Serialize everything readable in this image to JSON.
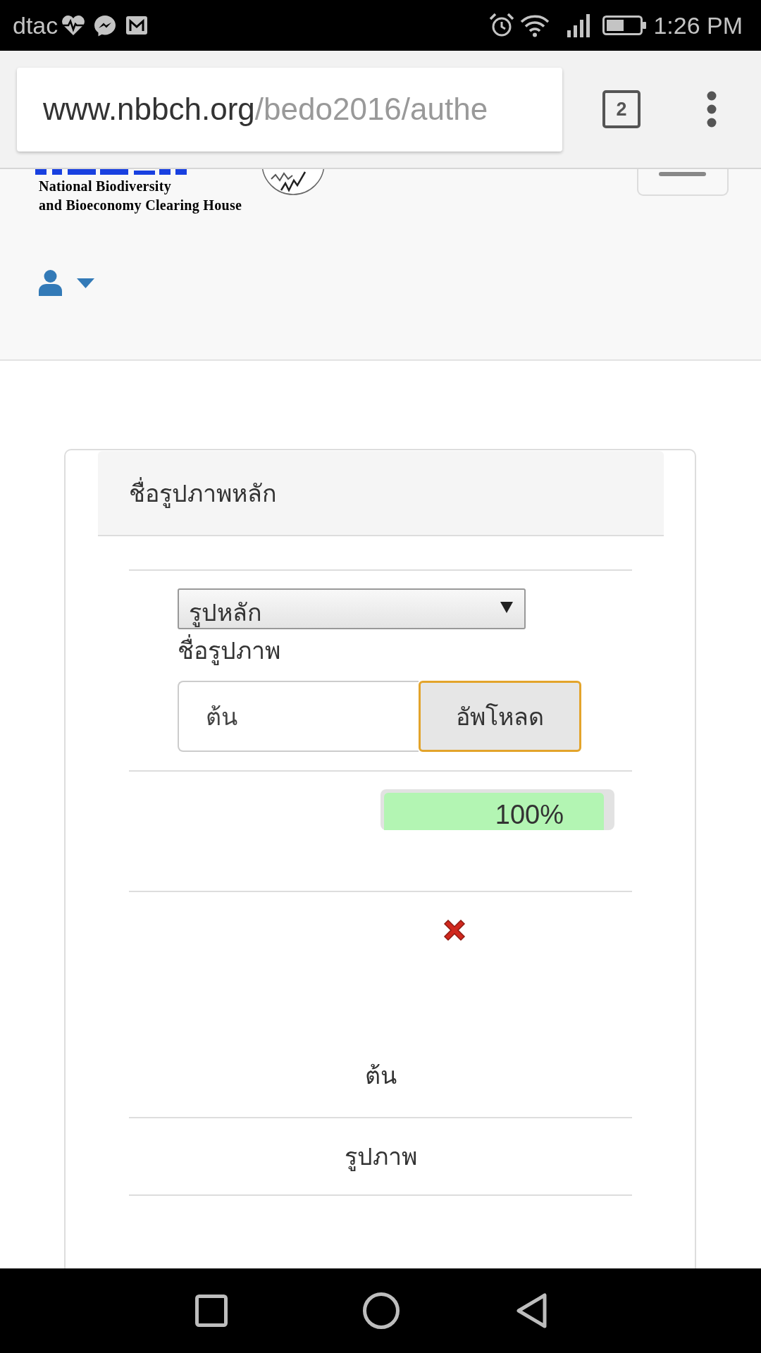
{
  "status_bar": {
    "carrier": "dtac",
    "time": "1:26 PM"
  },
  "browser": {
    "address_bar": {
      "host": "www.nbbch.org",
      "path": "/bedo2016/authe"
    },
    "tab_count": "2"
  },
  "site_header": {
    "logo_lines": [
      "National Biodiversity",
      "and Bioeconomy Clearing House"
    ]
  },
  "card": {
    "title": "ชื่อรูปภาพหลัก",
    "image_type_select": {
      "value": "รูปหลัก"
    },
    "name_label": "ชื่อรูปภาพ",
    "name_field": {
      "value": "ต้น"
    },
    "upload_button": {
      "label": "อัพโหลด",
      "focused": true
    },
    "progress": {
      "level": 1,
      "reading": "100%"
    },
    "file_name": "ต้น",
    "file_type": "รูปภาพ"
  }
}
